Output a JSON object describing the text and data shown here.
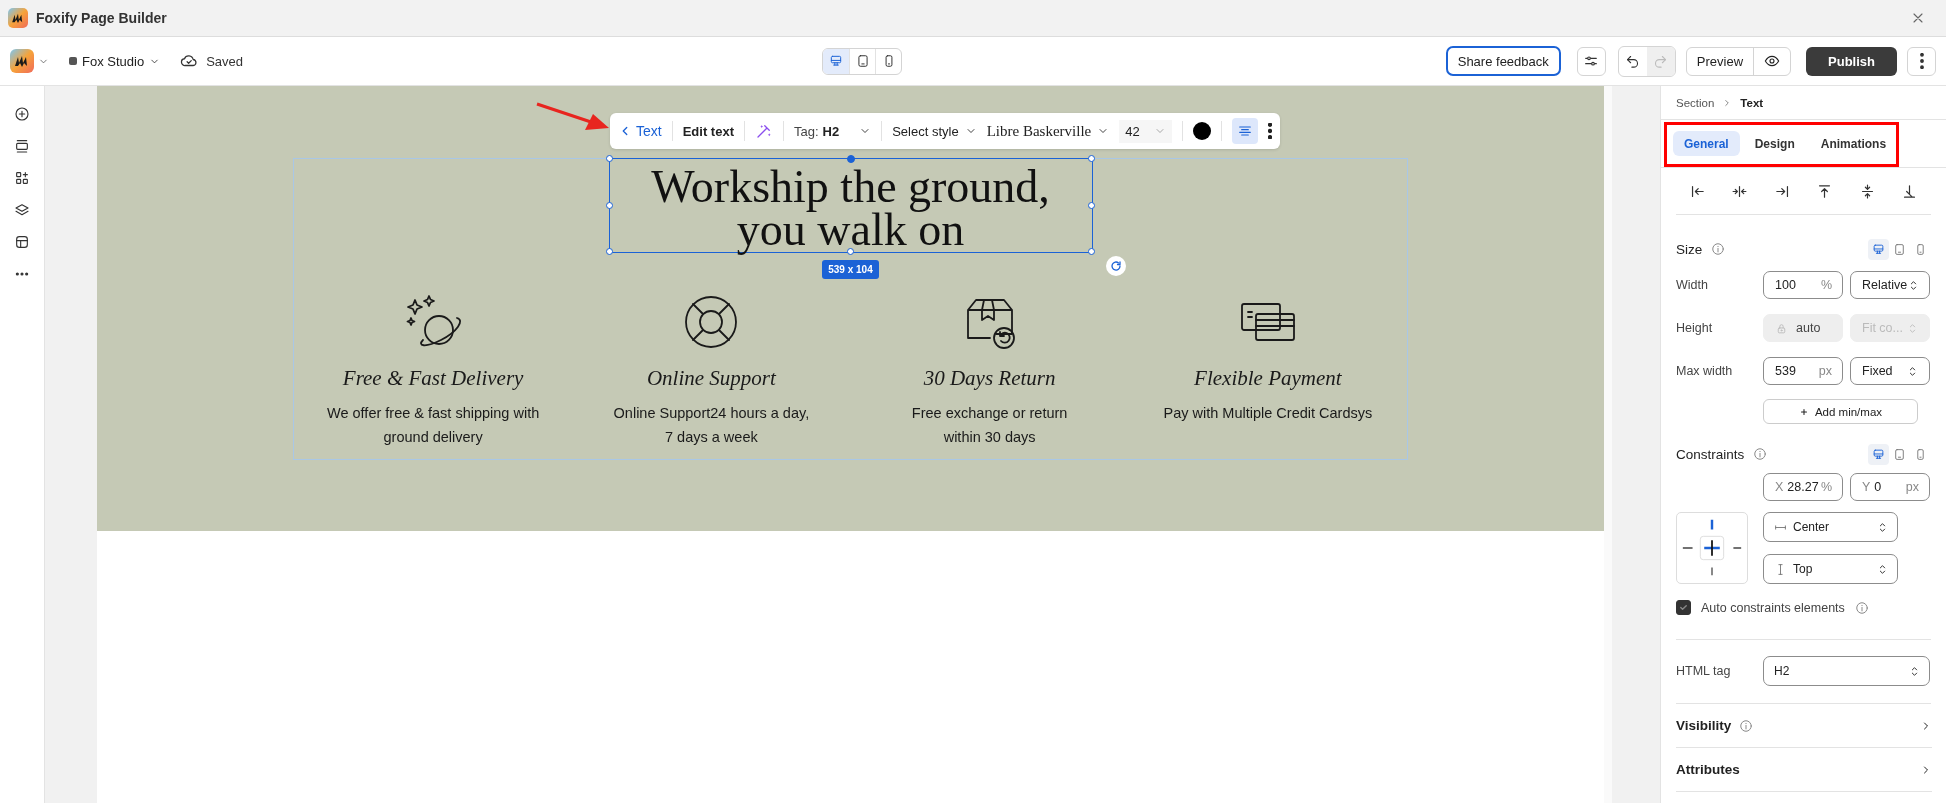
{
  "window": {
    "title": "Foxify Page Builder"
  },
  "header": {
    "store": "Fox Studio",
    "save_status": "Saved",
    "devices": [
      {
        "kind": "desktop",
        "selected": true
      },
      {
        "kind": "tablet",
        "selected": false
      },
      {
        "kind": "mobile",
        "selected": false
      }
    ],
    "feedback": "Share feedback",
    "history": [
      {
        "kind": "undo",
        "disabled": false
      },
      {
        "kind": "redo",
        "disabled": true
      }
    ],
    "preview": "Preview",
    "publish": "Publish"
  },
  "toolbar": {
    "back": "Text",
    "edit": "Edit text",
    "tag_label": "Tag:",
    "tag": "H2",
    "style": "Select style",
    "font": "Libre Baskerville",
    "size": "42",
    "color": "#000000",
    "align_selected": true
  },
  "heading": {
    "lines": [
      "Workship the ground,",
      "you walk on"
    ],
    "size_badge": "539 x 104"
  },
  "features": [
    {
      "kind": "planet",
      "title": "Free & Fast Delivery",
      "lines": [
        "We offer free & fast shipping with",
        "ground delivery"
      ]
    },
    {
      "kind": "lifebuoy",
      "title": "Online Support",
      "lines": [
        "Online Support24 hours a day,",
        "7 days a week"
      ]
    },
    {
      "kind": "box-return",
      "title": "30 Days Return",
      "lines": [
        "Free exchange or return",
        "within 30 days"
      ]
    },
    {
      "kind": "cards",
      "title": "Flexible Payment",
      "lines": [
        "Pay with Multiple Credit Cardsys"
      ]
    }
  ],
  "panel": {
    "breadcrumb": [
      "Section",
      "Text"
    ],
    "tabs": [
      {
        "label": "General",
        "selected": true
      },
      {
        "label": "Design",
        "selected": false
      },
      {
        "label": "Animations",
        "selected": false
      }
    ],
    "size": {
      "label": "Size",
      "devices": [
        {
          "kind": "desktop",
          "selected": true
        },
        {
          "kind": "tablet",
          "selected": false
        },
        {
          "kind": "mobile",
          "selected": false
        }
      ],
      "rows": [
        {
          "label": "Width",
          "value": "100",
          "unit": "%",
          "mode": "Relative",
          "disabled": false
        },
        {
          "label": "Height",
          "value": "auto",
          "mode": "Fit co...",
          "disabled": true
        },
        {
          "label": "Max width",
          "value": "539",
          "unit": "px",
          "mode": "Fixed",
          "disabled": false
        }
      ],
      "add_button": "Add min/max"
    },
    "constraints": {
      "label": "Constraints",
      "devices": [
        {
          "kind": "desktop",
          "selected": true
        },
        {
          "kind": "tablet",
          "selected": false
        },
        {
          "kind": "mobile",
          "selected": false
        }
      ],
      "x": {
        "prefix": "X",
        "value": "28.27",
        "unit": "%"
      },
      "y": {
        "prefix": "Y",
        "value": "0",
        "unit": "px"
      },
      "horizontal": "Center",
      "vertical": "Top",
      "auto": {
        "label": "Auto constraints elements",
        "checked": true
      }
    },
    "html_tag": {
      "label": "HTML tag",
      "value": "H2"
    },
    "sections": [
      {
        "label": "Visibility",
        "info": true
      },
      {
        "label": "Attributes",
        "info": false
      }
    ]
  }
}
